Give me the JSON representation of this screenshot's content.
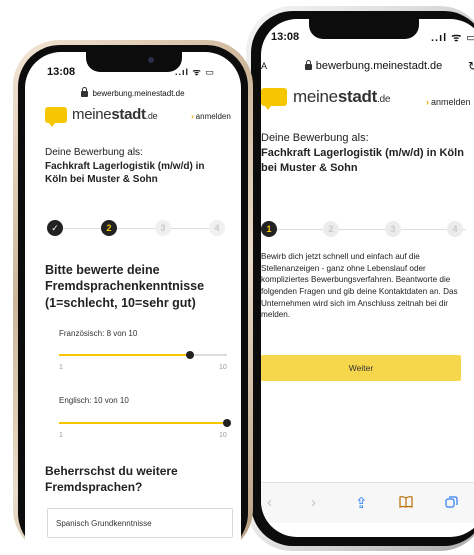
{
  "back": {
    "status_time": "13:08",
    "status_icons": "..ıl ᯤ ▭",
    "url_aa": "AA",
    "url": "bewerbung.meinestadt.de",
    "reload_glyph": "↻",
    "logo_light": "meine",
    "logo_bold": "stadt",
    "logo_tld": ".de",
    "login": "anmelden",
    "intro": "Deine Bewerbung als:",
    "job": "Fachkraft Lagerlogistik (m/w/d) in Köln bei Muster & Sohn",
    "steps": [
      "1",
      "2",
      "3",
      "4"
    ],
    "description": "Bewirb dich jetzt schnell und einfach auf die Stellenanzeigen - ganz ohne Lebenslauf oder kompliziertes Bewerbungsverfahren. Beantworte die folgenden Fragen und gib deine Kontaktdaten an. Das Unternehmen wird sich im Anschluss zeitnah bei dir melden.",
    "button": "Weiter",
    "toolbar_glyphs": {
      "back": "‹",
      "forward": "›",
      "share": "⇪",
      "bookmarks": "📖",
      "tabs": "⧉"
    }
  },
  "front": {
    "status_time": "13:08",
    "status_icons": "..ıl ᯤ ▭",
    "url": "bewerbung.meinestadt.de",
    "logo_light": "meine",
    "logo_bold": "stadt",
    "logo_tld": ".de",
    "login": "anmelden",
    "intro": "Deine Bewerbung als:",
    "job": "Fachkraft Lagerlogistik (m/w/d) in Köln bei Muster & Sohn",
    "steps": [
      "✓",
      "2",
      "3",
      "4"
    ],
    "question": "Bitte bewerte deine Fremdsprachenkenntnisse (1=schlecht, 10=sehr gut)",
    "sliders": [
      {
        "label": "Französisch: 8 von 10",
        "value": 8,
        "min": "1",
        "max": "10"
      },
      {
        "label": "Englisch: 10 von 10",
        "value": 10,
        "min": "1",
        "max": "10"
      }
    ],
    "question2": "Beherrschst du weitere Fremdsprachen?",
    "input_value": "Spanisch Grundkenntnisse"
  },
  "colors": {
    "accent": "#f6c600",
    "login_arrow": "#f0a800",
    "ios_blue": "#2e7cf6"
  }
}
